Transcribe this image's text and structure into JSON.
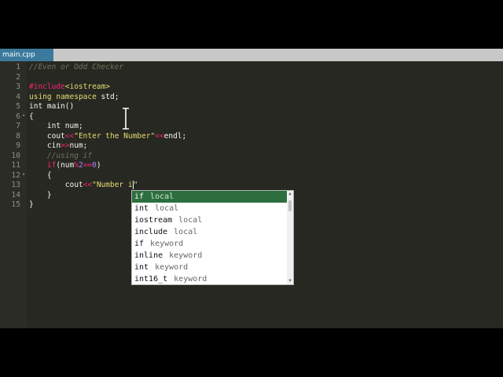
{
  "tab": {
    "label": "main.cpp"
  },
  "line_numbers": [
    "1",
    "2",
    "3",
    "4",
    "5",
    "6",
    "7",
    "8",
    "9",
    "10",
    "11",
    "12",
    "13",
    "14",
    "15"
  ],
  "code": {
    "l1": "//Even or Odd Checker",
    "l3_directive": "#include",
    "l3_header": "<iostream>",
    "l4_kw1": "using",
    "l4_kw2": "namespace",
    "l4_rest": " std;",
    "l5": "int main()",
    "l6": "{",
    "l7": "    int num;",
    "l8_a": "    cout",
    "l8_op1": "<<",
    "l8_str": "\"Enter the Number\"",
    "l8_op2": "<<",
    "l8_end": "endl;",
    "l9_a": "    cin",
    "l9_op": ">>",
    "l9_b": "num;",
    "l10": "    //using if",
    "l11_kw": "    if",
    "l11_a": "(num",
    "l11_op": "%",
    "l11_n1": "2",
    "l11_op2": "==",
    "l11_n2": "0",
    "l11_b": ")",
    "l12": "    {",
    "l13_a": "        cout",
    "l13_op": "<<",
    "l13_str": "\"Number i",
    "l13_quote": "\"",
    "l14": "    }",
    "l15": "}"
  },
  "autocomplete": {
    "items": [
      {
        "label": "if",
        "kind": "local"
      },
      {
        "label": "int",
        "kind": "local"
      },
      {
        "label": "iostream",
        "kind": "local"
      },
      {
        "label": "include",
        "kind": "local"
      },
      {
        "label": "if",
        "kind": "keyword"
      },
      {
        "label": "inline",
        "kind": "keyword"
      },
      {
        "label": "int",
        "kind": "keyword"
      },
      {
        "label": "int16_t",
        "kind": "keyword"
      }
    ],
    "selected_index": 0
  },
  "colors": {
    "editor_bg": "#272822",
    "selection": "#2d6e3e",
    "tab_active": "#3b7a9c"
  }
}
